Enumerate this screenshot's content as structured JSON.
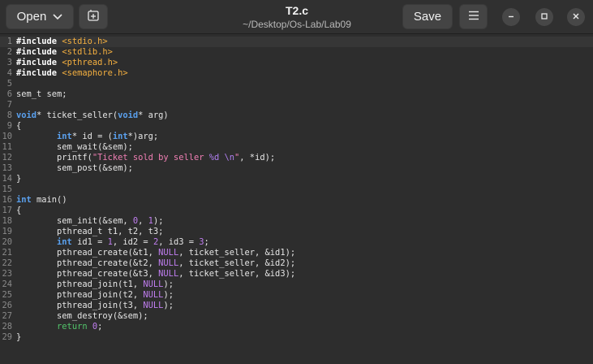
{
  "titlebar": {
    "open_label": "Open",
    "title": "T2.c",
    "subtitle": "~/Desktop/Os-Lab/Lab09",
    "save_label": "Save"
  },
  "editor": {
    "current_line": 1,
    "lines": [
      {
        "n": "1",
        "tokens": [
          {
            "t": "pp",
            "v": "#include "
          },
          {
            "t": "inc",
            "v": "<stdio.h>"
          }
        ]
      },
      {
        "n": "2",
        "tokens": [
          {
            "t": "pp",
            "v": "#include "
          },
          {
            "t": "inc",
            "v": "<stdlib.h>"
          }
        ]
      },
      {
        "n": "3",
        "tokens": [
          {
            "t": "pp",
            "v": "#include "
          },
          {
            "t": "inc",
            "v": "<pthread.h>"
          }
        ]
      },
      {
        "n": "4",
        "tokens": [
          {
            "t": "pp",
            "v": "#include "
          },
          {
            "t": "inc",
            "v": "<semaphore.h>"
          }
        ]
      },
      {
        "n": "5",
        "tokens": []
      },
      {
        "n": "6",
        "tokens": [
          {
            "t": "txt",
            "v": "sem_t sem;"
          }
        ]
      },
      {
        "n": "7",
        "tokens": []
      },
      {
        "n": "8",
        "tokens": [
          {
            "t": "kw",
            "v": "void"
          },
          {
            "t": "txt",
            "v": "* ticket_seller("
          },
          {
            "t": "kw",
            "v": "void"
          },
          {
            "t": "txt",
            "v": "* arg)"
          }
        ]
      },
      {
        "n": "9",
        "tokens": [
          {
            "t": "txt",
            "v": "{"
          }
        ]
      },
      {
        "n": "10",
        "tokens": [
          {
            "t": "txt",
            "v": "        "
          },
          {
            "t": "kw",
            "v": "int"
          },
          {
            "t": "txt",
            "v": "* id = ("
          },
          {
            "t": "kw",
            "v": "int"
          },
          {
            "t": "txt",
            "v": "*)arg;"
          }
        ]
      },
      {
        "n": "11",
        "tokens": [
          {
            "t": "txt",
            "v": "        sem_wait(&sem);"
          }
        ]
      },
      {
        "n": "12",
        "tokens": [
          {
            "t": "txt",
            "v": "        printf("
          },
          {
            "t": "str",
            "v": "\"Ticket sold by seller "
          },
          {
            "t": "esc",
            "v": "%d"
          },
          {
            "t": "str",
            "v": " "
          },
          {
            "t": "esc",
            "v": "\\n"
          },
          {
            "t": "str",
            "v": "\""
          },
          {
            "t": "txt",
            "v": ", *id);"
          }
        ]
      },
      {
        "n": "13",
        "tokens": [
          {
            "t": "txt",
            "v": "        sem_post(&sem);"
          }
        ]
      },
      {
        "n": "14",
        "tokens": [
          {
            "t": "txt",
            "v": "}"
          }
        ]
      },
      {
        "n": "15",
        "tokens": []
      },
      {
        "n": "16",
        "tokens": [
          {
            "t": "kw",
            "v": "int"
          },
          {
            "t": "txt",
            "v": " main()"
          }
        ]
      },
      {
        "n": "17",
        "tokens": [
          {
            "t": "txt",
            "v": "{"
          }
        ]
      },
      {
        "n": "18",
        "tokens": [
          {
            "t": "txt",
            "v": "        sem_init(&sem, "
          },
          {
            "t": "num",
            "v": "0"
          },
          {
            "t": "txt",
            "v": ", "
          },
          {
            "t": "num",
            "v": "1"
          },
          {
            "t": "txt",
            "v": ");"
          }
        ]
      },
      {
        "n": "19",
        "tokens": [
          {
            "t": "txt",
            "v": "        pthread_t t1, t2, t3;"
          }
        ]
      },
      {
        "n": "20",
        "tokens": [
          {
            "t": "txt",
            "v": "        "
          },
          {
            "t": "kw",
            "v": "int"
          },
          {
            "t": "txt",
            "v": " id1 = "
          },
          {
            "t": "num",
            "v": "1"
          },
          {
            "t": "txt",
            "v": ", id2 = "
          },
          {
            "t": "num",
            "v": "2"
          },
          {
            "t": "txt",
            "v": ", id3 = "
          },
          {
            "t": "num",
            "v": "3"
          },
          {
            "t": "txt",
            "v": ";"
          }
        ]
      },
      {
        "n": "21",
        "tokens": [
          {
            "t": "txt",
            "v": "        pthread_create(&t1, "
          },
          {
            "t": "null",
            "v": "NULL"
          },
          {
            "t": "txt",
            "v": ", ticket_seller, &id1);"
          }
        ]
      },
      {
        "n": "22",
        "tokens": [
          {
            "t": "txt",
            "v": "        pthread_create(&t2, "
          },
          {
            "t": "null",
            "v": "NULL"
          },
          {
            "t": "txt",
            "v": ", ticket_seller, &id2);"
          }
        ]
      },
      {
        "n": "23",
        "tokens": [
          {
            "t": "txt",
            "v": "        pthread_create(&t3, "
          },
          {
            "t": "null",
            "v": "NULL"
          },
          {
            "t": "txt",
            "v": ", ticket_seller, &id3);"
          }
        ]
      },
      {
        "n": "24",
        "tokens": [
          {
            "t": "txt",
            "v": "        pthread_join(t1, "
          },
          {
            "t": "null",
            "v": "NULL"
          },
          {
            "t": "txt",
            "v": ");"
          }
        ]
      },
      {
        "n": "25",
        "tokens": [
          {
            "t": "txt",
            "v": "        pthread_join(t2, "
          },
          {
            "t": "null",
            "v": "NULL"
          },
          {
            "t": "txt",
            "v": ");"
          }
        ]
      },
      {
        "n": "26",
        "tokens": [
          {
            "t": "txt",
            "v": "        pthread_join(t3, "
          },
          {
            "t": "null",
            "v": "NULL"
          },
          {
            "t": "txt",
            "v": ");"
          }
        ]
      },
      {
        "n": "27",
        "tokens": [
          {
            "t": "txt",
            "v": "        sem_destroy(&sem);"
          }
        ]
      },
      {
        "n": "28",
        "tokens": [
          {
            "t": "txt",
            "v": "        "
          },
          {
            "t": "ret",
            "v": "return"
          },
          {
            "t": "txt",
            "v": " "
          },
          {
            "t": "num",
            "v": "0"
          },
          {
            "t": "txt",
            "v": ";"
          }
        ]
      },
      {
        "n": "29",
        "tokens": [
          {
            "t": "txt",
            "v": "}"
          }
        ]
      }
    ]
  },
  "colors": {
    "background": "#2d2d2d",
    "keyword": "#5aa0ee",
    "include_path": "#f5b040",
    "string": "#f07fb4",
    "number": "#c07ef0",
    "return": "#52c46a"
  },
  "icons": [
    "chevron-down-icon",
    "new-tab-icon",
    "hamburger-menu-icon",
    "minimize-icon",
    "maximize-icon",
    "close-icon"
  ]
}
